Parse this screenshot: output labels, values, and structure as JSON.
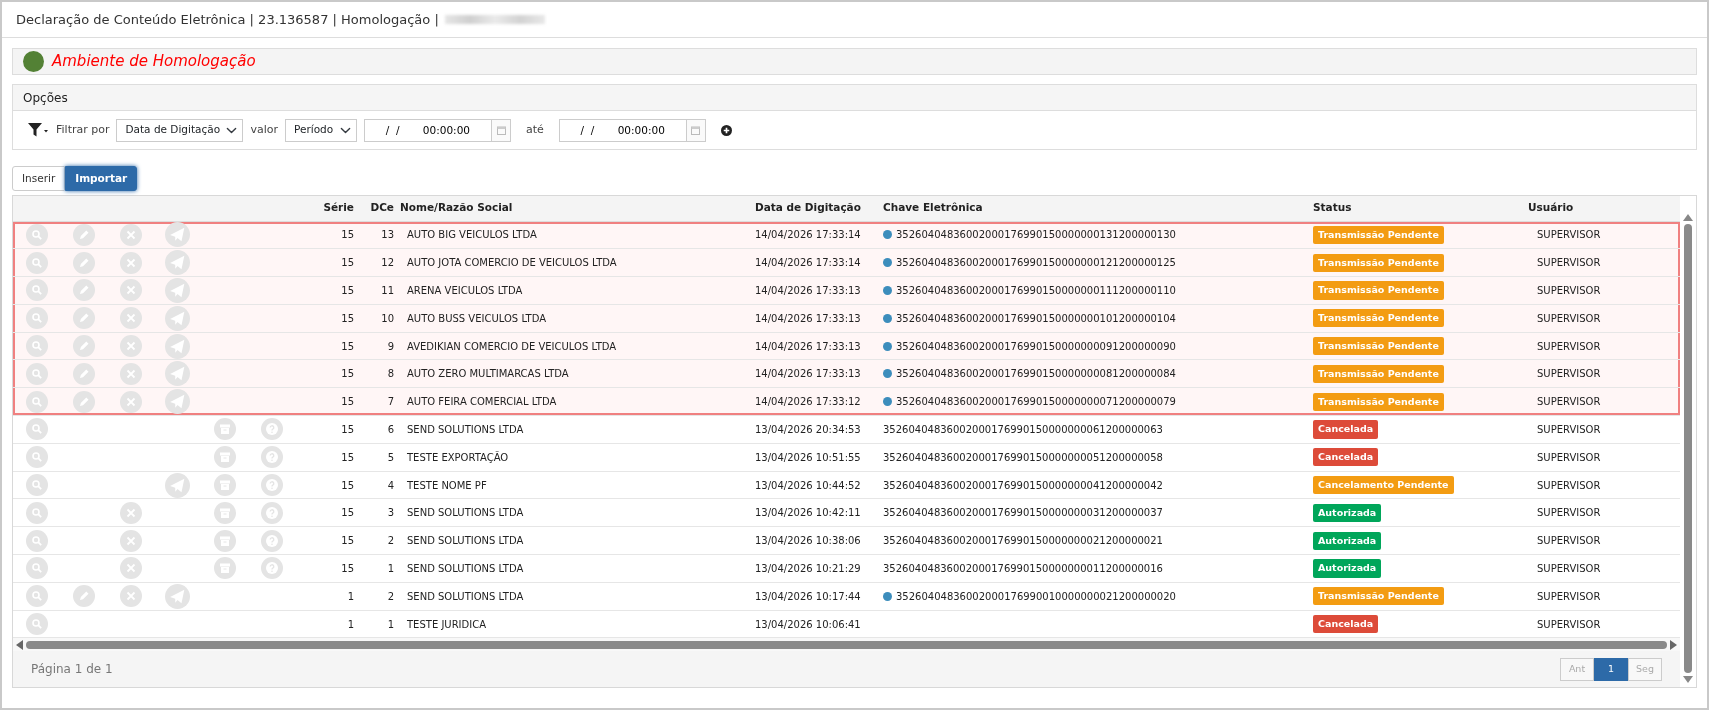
{
  "window": {
    "title": "Declaração de Conteúdo Eletrônica | 23.136587 | Homologação |"
  },
  "environment": {
    "label": "Ambiente de Homologação",
    "color": "#538135"
  },
  "options": {
    "title": "Opções",
    "filter_label": "Filtrar por",
    "filter_field": "Data de Digitação",
    "value_label": "valor",
    "value_mode": "Período",
    "date_from": "     /  /       00:00:00",
    "until_label": "até",
    "date_to": "     /  /       00:00:00"
  },
  "toolbar": {
    "buttons": [
      {
        "label": "Inserir",
        "selected": false
      },
      {
        "label": "Importar",
        "selected": true
      }
    ]
  },
  "table": {
    "columns": [
      "Série",
      "DCe",
      "Nome/Razão Social",
      "Data de Digitação",
      "Chave Eletrônica",
      "Status",
      "Usuário"
    ],
    "rows": [
      {
        "serie": "15",
        "dce": "13",
        "name": "AUTO BIG VEICULOS LTDA",
        "date": "14/04/2026 17:33:14",
        "key": "35260404836002000176990150000000131200000130",
        "marked": true,
        "status": {
          "text": "Transmissão Pendente",
          "color": "#f39c12"
        },
        "user": "SUPERVISOR",
        "selected": true,
        "actions": [
          {
            "kind": "search"
          },
          {
            "kind": "edit"
          },
          {
            "kind": "cancel"
          },
          {
            "kind": "send"
          }
        ]
      },
      {
        "serie": "15",
        "dce": "12",
        "name": "AUTO JOTA COMERCIO DE VEICULOS LTDA",
        "date": "14/04/2026 17:33:14",
        "key": "35260404836002000176990150000000121200000125",
        "marked": true,
        "status": {
          "text": "Transmissão Pendente",
          "color": "#f39c12"
        },
        "user": "SUPERVISOR",
        "selected": true,
        "actions": [
          {
            "kind": "search"
          },
          {
            "kind": "edit"
          },
          {
            "kind": "cancel"
          },
          {
            "kind": "send"
          }
        ]
      },
      {
        "serie": "15",
        "dce": "11",
        "name": "ARENA VEICULOS LTDA",
        "date": "14/04/2026 17:33:13",
        "key": "35260404836002000176990150000000111200000110",
        "marked": true,
        "status": {
          "text": "Transmissão Pendente",
          "color": "#f39c12"
        },
        "user": "SUPERVISOR",
        "selected": true,
        "actions": [
          {
            "kind": "search"
          },
          {
            "kind": "edit"
          },
          {
            "kind": "cancel"
          },
          {
            "kind": "send"
          }
        ]
      },
      {
        "serie": "15",
        "dce": "10",
        "name": "AUTO BUSS VEICULOS LTDA",
        "date": "14/04/2026 17:33:13",
        "key": "35260404836002000176990150000000101200000104",
        "marked": true,
        "status": {
          "text": "Transmissão Pendente",
          "color": "#f39c12"
        },
        "user": "SUPERVISOR",
        "selected": true,
        "actions": [
          {
            "kind": "search"
          },
          {
            "kind": "edit"
          },
          {
            "kind": "cancel"
          },
          {
            "kind": "send"
          }
        ]
      },
      {
        "serie": "15",
        "dce": "9",
        "name": "AVEDIKIAN COMERCIO DE VEICULOS LTDA",
        "date": "14/04/2026 17:33:13",
        "key": "35260404836002000176990150000000091200000090",
        "marked": true,
        "status": {
          "text": "Transmissão Pendente",
          "color": "#f39c12"
        },
        "user": "SUPERVISOR",
        "selected": true,
        "actions": [
          {
            "kind": "search"
          },
          {
            "kind": "edit"
          },
          {
            "kind": "cancel"
          },
          {
            "kind": "send"
          }
        ]
      },
      {
        "serie": "15",
        "dce": "8",
        "name": "AUTO ZERO MULTIMARCAS LTDA",
        "date": "14/04/2026 17:33:13",
        "key": "35260404836002000176990150000000081200000084",
        "marked": true,
        "status": {
          "text": "Transmissão Pendente",
          "color": "#f39c12"
        },
        "user": "SUPERVISOR",
        "selected": true,
        "actions": [
          {
            "kind": "search"
          },
          {
            "kind": "edit"
          },
          {
            "kind": "cancel"
          },
          {
            "kind": "send"
          }
        ]
      },
      {
        "serie": "15",
        "dce": "7",
        "name": "AUTO FEIRA COMERCIAL LTDA",
        "date": "14/04/2026 17:33:12",
        "key": "35260404836002000176990150000000071200000079",
        "marked": true,
        "status": {
          "text": "Transmissão Pendente",
          "color": "#f39c12"
        },
        "user": "SUPERVISOR",
        "selected": true,
        "actions": [
          {
            "kind": "search"
          },
          {
            "kind": "edit"
          },
          {
            "kind": "cancel"
          },
          {
            "kind": "send"
          }
        ]
      },
      {
        "serie": "15",
        "dce": "6",
        "name": "SEND SOLUTIONS LTDA",
        "date": "13/04/2026 20:34:53",
        "key": "35260404836002000176990150000000061200000063",
        "marked": false,
        "status": {
          "text": "Cancelada",
          "color": "#dd4b39"
        },
        "user": "SUPERVISOR",
        "selected": false,
        "actions": [
          {
            "kind": "search"
          },
          {
            "kind": "archive"
          },
          {
            "kind": "help"
          }
        ]
      },
      {
        "serie": "15",
        "dce": "5",
        "name": "TESTE EXPORTAÇÃO",
        "date": "13/04/2026 10:51:55",
        "key": "35260404836002000176990150000000051200000058",
        "marked": false,
        "status": {
          "text": "Cancelada",
          "color": "#dd4b39"
        },
        "user": "SUPERVISOR",
        "selected": false,
        "actions": [
          {
            "kind": "search"
          },
          {
            "kind": "archive"
          },
          {
            "kind": "help"
          }
        ]
      },
      {
        "serie": "15",
        "dce": "4",
        "name": "TESTE NOME PF",
        "date": "13/04/2026 10:44:52",
        "key": "35260404836002000176990150000000041200000042",
        "marked": false,
        "status": {
          "text": "Cancelamento Pendente",
          "color": "#f39c12"
        },
        "user": "SUPERVISOR",
        "selected": false,
        "actions": [
          {
            "kind": "search"
          },
          {
            "kind": "send"
          },
          {
            "kind": "archive"
          },
          {
            "kind": "help"
          }
        ]
      },
      {
        "serie": "15",
        "dce": "3",
        "name": "SEND SOLUTIONS LTDA",
        "date": "13/04/2026 10:42:11",
        "key": "35260404836002000176990150000000031200000037",
        "marked": false,
        "status": {
          "text": "Autorizada",
          "color": "#00a65a"
        },
        "user": "SUPERVISOR",
        "selected": false,
        "actions": [
          {
            "kind": "search"
          },
          {
            "kind": "cancel"
          },
          {
            "kind": "archive"
          },
          {
            "kind": "help"
          }
        ]
      },
      {
        "serie": "15",
        "dce": "2",
        "name": "SEND SOLUTIONS LTDA",
        "date": "13/04/2026 10:38:06",
        "key": "35260404836002000176990150000000021200000021",
        "marked": false,
        "status": {
          "text": "Autorizada",
          "color": "#00a65a"
        },
        "user": "SUPERVISOR",
        "selected": false,
        "actions": [
          {
            "kind": "search"
          },
          {
            "kind": "cancel"
          },
          {
            "kind": "archive"
          },
          {
            "kind": "help"
          }
        ]
      },
      {
        "serie": "15",
        "dce": "1",
        "name": "SEND SOLUTIONS LTDA",
        "date": "13/04/2026 10:21:29",
        "key": "35260404836002000176990150000000011200000016",
        "marked": false,
        "status": {
          "text": "Autorizada",
          "color": "#00a65a"
        },
        "user": "SUPERVISOR",
        "selected": false,
        "actions": [
          {
            "kind": "search"
          },
          {
            "kind": "cancel"
          },
          {
            "kind": "archive"
          },
          {
            "kind": "help"
          }
        ]
      },
      {
        "serie": "1",
        "dce": "2",
        "name": "SEND SOLUTIONS LTDA",
        "date": "13/04/2026 10:17:44",
        "key": "35260404836002000176990010000000021200000020",
        "marked": true,
        "status": {
          "text": "Transmissão Pendente",
          "color": "#f39c12"
        },
        "user": "SUPERVISOR",
        "selected": false,
        "actions": [
          {
            "kind": "search"
          },
          {
            "kind": "edit"
          },
          {
            "kind": "cancel"
          },
          {
            "kind": "send"
          }
        ]
      },
      {
        "serie": "1",
        "dce": "1",
        "name": "TESTE JURIDICA",
        "date": "13/04/2026 10:06:41",
        "status": {
          "text": "Cancelada",
          "color": "#dd4b39"
        },
        "user": "SUPERVISOR",
        "selected": false,
        "actions": [
          {
            "kind": "search"
          }
        ]
      }
    ]
  },
  "pagination": {
    "summary": "Página 1 de 1",
    "prev": {
      "label": "Ant",
      "disabled": true
    },
    "pages": [
      {
        "label": "1",
        "selected": true
      }
    ],
    "next": {
      "label": "Seg",
      "disabled": true
    }
  }
}
